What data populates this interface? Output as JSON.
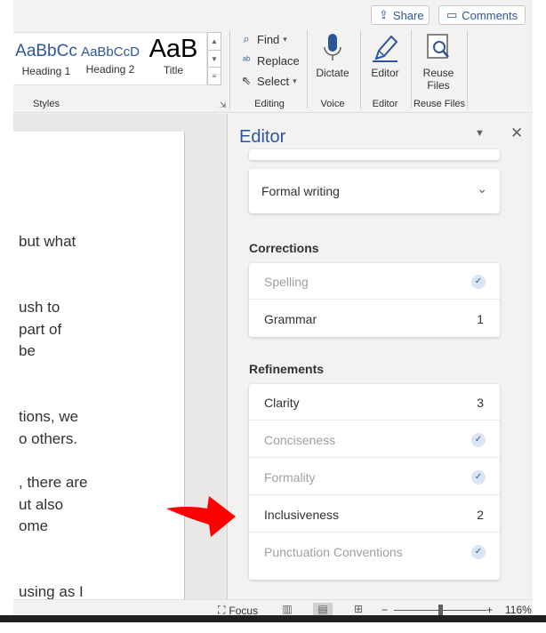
{
  "header": {
    "share_label": "Share",
    "comments_label": "Comments"
  },
  "styles": {
    "group_label": "Styles",
    "items": [
      {
        "sample": "AaBbCc",
        "name": "Heading 1"
      },
      {
        "sample": "AaBbCcD",
        "name": "Heading 2"
      },
      {
        "sample": "AaB",
        "name": "Title"
      }
    ]
  },
  "editing": {
    "group_label": "Editing",
    "find_label": "Find",
    "replace_label": "Replace",
    "select_label": "Select"
  },
  "voice": {
    "group_label": "Voice",
    "dictate_label": "Dictate"
  },
  "editor_group": {
    "group_label": "Editor",
    "editor_label": "Editor"
  },
  "reuse": {
    "group_label": "Reuse Files",
    "label_line1": "Reuse",
    "label_line2": "Files"
  },
  "document": {
    "lines": [
      " but what",
      "ush to",
      " part of",
      " be",
      "tions, we",
      "o others.",
      ", there are",
      "ut also",
      "ome",
      "using as I"
    ]
  },
  "pane": {
    "title": "Editor",
    "writing_style": "Formal writing",
    "corrections_heading": "Corrections",
    "corrections": [
      {
        "label": "Spelling",
        "count": null,
        "done": true
      },
      {
        "label": "Grammar",
        "count": "1",
        "done": false
      }
    ],
    "refinements_heading": "Refinements",
    "refinements": [
      {
        "label": "Clarity",
        "count": "3",
        "done": false
      },
      {
        "label": "Conciseness",
        "count": null,
        "done": true
      },
      {
        "label": "Formality",
        "count": null,
        "done": true
      },
      {
        "label": "Inclusiveness",
        "count": "2",
        "done": false
      },
      {
        "label": "Punctuation Conventions",
        "count": null,
        "done": true
      }
    ]
  },
  "status": {
    "focus_label": "Focus",
    "zoom_level": "116%"
  },
  "colors": {
    "accent": "#2b579a",
    "arrow": "#ff0000",
    "ribbon_bg": "#f3f2f1"
  }
}
